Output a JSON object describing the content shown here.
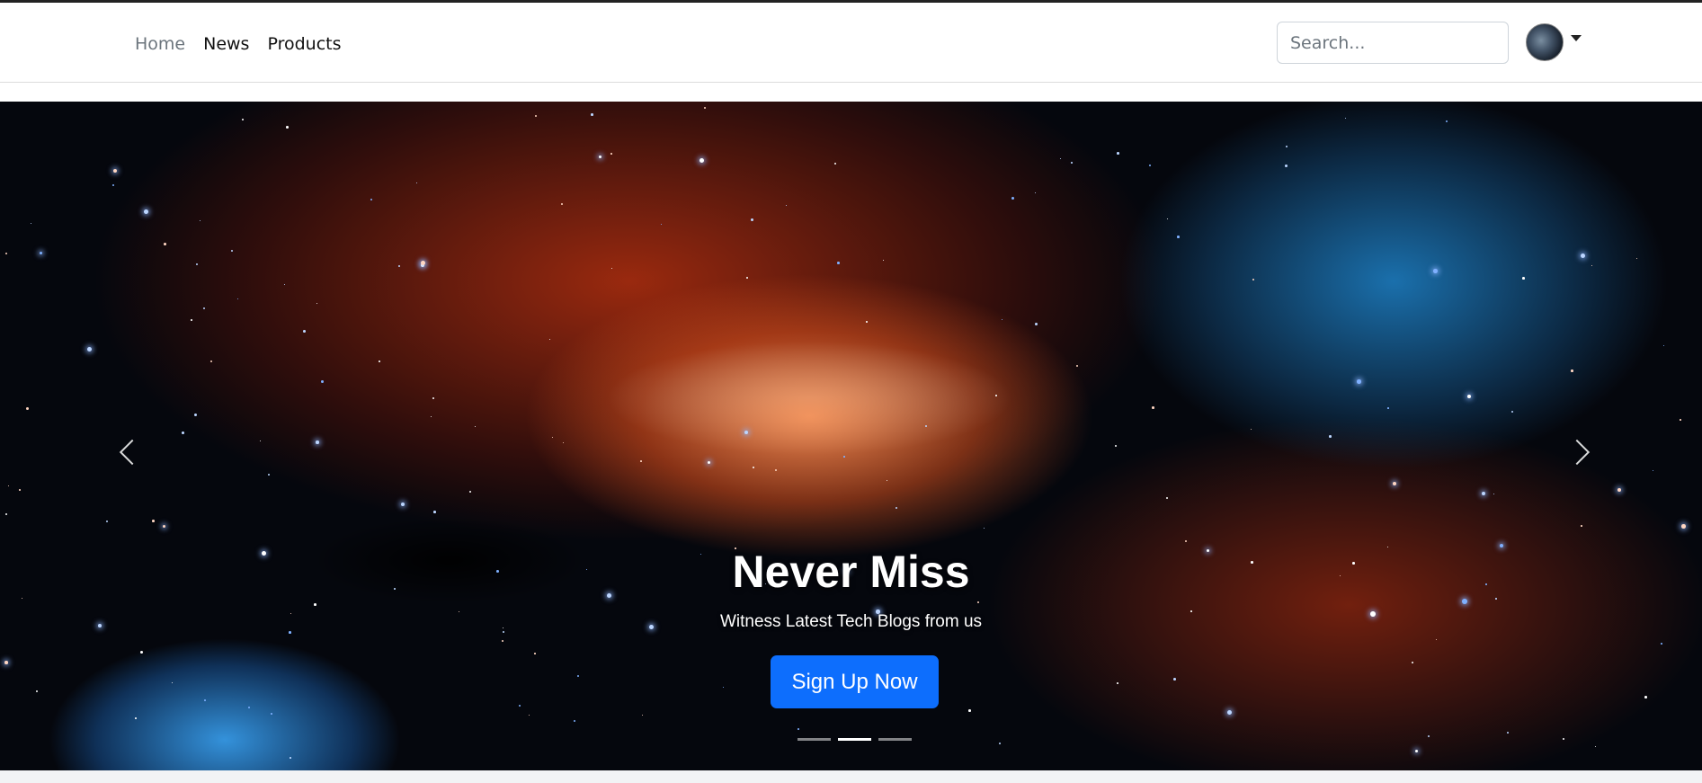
{
  "nav": {
    "links": [
      {
        "label": "Home",
        "active": true
      },
      {
        "label": "News",
        "active": false
      },
      {
        "label": "Products",
        "active": false
      }
    ]
  },
  "search": {
    "placeholder": "Search...",
    "value": ""
  },
  "profile": {
    "icon": "avatar-icon",
    "dropdown_icon": "caret-down-icon"
  },
  "hero": {
    "title": "Never Miss",
    "subtitle": "Witness Latest Tech Blogs from us",
    "cta_label": "Sign Up Now",
    "active_slide": 2,
    "slide_count": 3,
    "prev_icon": "chevron-left-icon",
    "next_icon": "chevron-right-icon"
  },
  "colors": {
    "primary": "#0d6efd",
    "nav_active": "#6c757d",
    "text": "#111111"
  }
}
